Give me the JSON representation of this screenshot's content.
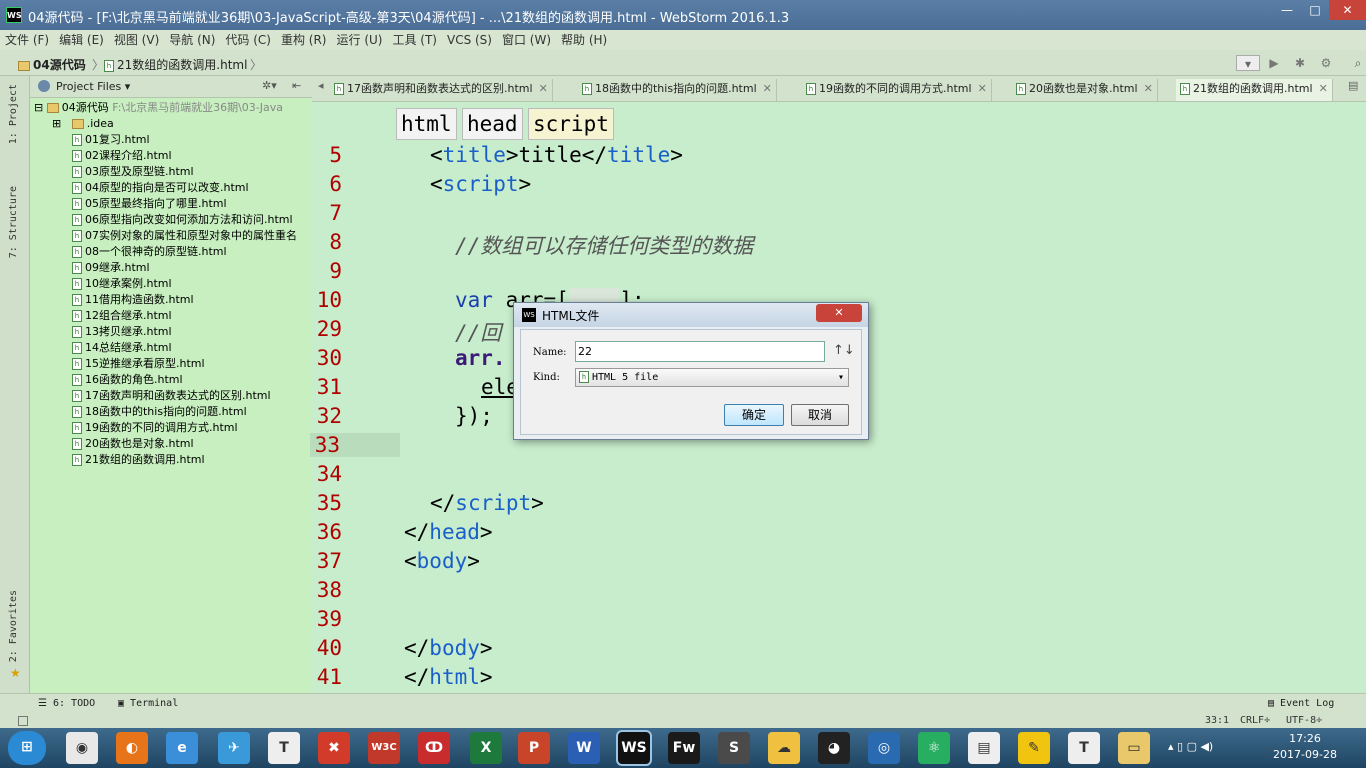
{
  "window": {
    "app_icon": "WS",
    "title": "04源代码 - [F:\\北京黑马前端就业36期\\03-JavaScript-高级-第3天\\04源代码] - ...\\21数组的函数调用.html - WebStorm 2016.1.3",
    "min": "—",
    "max": "□",
    "close": "✕"
  },
  "menu": [
    "文件 (F)",
    "编辑 (E)",
    "视图 (V)",
    "导航 (N)",
    "代码 (C)",
    "重构 (R)",
    "运行 (U)",
    "工具 (T)",
    "VCS (S)",
    "窗口 (W)",
    "帮助 (H)"
  ],
  "nav": {
    "crumb1": "04源代码",
    "crumb2": "21数组的函数调用.html",
    "sep": "〉"
  },
  "side_tabs": {
    "project": "1: Project",
    "structure": "7: Structure",
    "favorites": "2: Favorites"
  },
  "project": {
    "header": "Project Files",
    "root": "04源代码",
    "root_path": "F:\\北京黑马前端就业36期\\03-Java",
    "idea": ".idea",
    "files": [
      "01复习.html",
      "02课程介绍.html",
      "03原型及原型链.html",
      "04原型的指向是否可以改变.html",
      "05原型最终指向了哪里.html",
      "06原型指向改变如何添加方法和访问.html",
      "07实例对象的属性和原型对象中的属性重名",
      "08一个很神奇的原型链.html",
      "09继承.html",
      "10继承案例.html",
      "11借用构造函数.html",
      "12组合继承.html",
      "13拷贝继承.html",
      "14总结继承.html",
      "15逆推继承看原型.html",
      "16函数的角色.html",
      "17函数声明和函数表达式的区别.html",
      "18函数中的this指向的问题.html",
      "19函数的不同的调用方式.html",
      "20函数也是对象.html",
      "21数组的函数调用.html"
    ]
  },
  "tabs": [
    "17函数声明和函数表达式的区别.html",
    "18函数中的this指向的问题.html",
    "19函数的不同的调用方式.html",
    "20函数也是对象.html",
    "21数组的函数调用.html"
  ],
  "editor": {
    "breadcrumbs": [
      "html",
      "head",
      "script"
    ],
    "line_numbers": [
      "5",
      "6",
      "7",
      "8",
      "9",
      "10",
      "29",
      "30",
      "31",
      "32",
      "33",
      "34",
      "35",
      "36",
      "37",
      "38",
      "39",
      "40",
      "41"
    ],
    "lines": {
      "l5_open": "<",
      "l5_tag": "title",
      "l5_mid": ">title</",
      "l5_tag2": "title",
      "l5_close": ">",
      "l6_open": "<",
      "l6_tag": "script",
      "l6_close": ">",
      "l8": "//数组可以存储任何类型的数据",
      "l10_kw": "var",
      "l10_rest": " arr=[",
      "l10_end": "];",
      "l29": "//回",
      "l30": "arr.",
      "l31": "ele",
      "l32": "});",
      "l35_open": "</",
      "l35_tag": "script",
      "l35_close": ">",
      "l36_open": "</",
      "l36_tag": "head",
      "l36_close": ">",
      "l37_open": "<",
      "l37_tag": "body",
      "l37_close": ">",
      "l40_open": "</",
      "l40_tag": "body",
      "l40_close": ">",
      "l41_open": "</",
      "l41_tag": "html",
      "l41_close": ">"
    }
  },
  "dialog": {
    "title": "HTML文件",
    "name_label": "Name:",
    "name_value": "22",
    "kind_label": "Kind:",
    "kind_value": "HTML 5 file",
    "ok": "确定",
    "cancel": "取消",
    "sort": "↑↓"
  },
  "bottom": {
    "todo": "6: TODO",
    "terminal": "Terminal",
    "event_log": "Event Log",
    "status_pos": "33:1",
    "status_crlf": "CRLF÷",
    "status_enc": "UTF-8÷"
  },
  "taskbar": {
    "time": "17:26",
    "date": "2017-09-28",
    "apps": [
      "start",
      "chrome",
      "firefox",
      "ie",
      "feiq",
      "typora",
      "xmind",
      "w3c",
      "foxit",
      "excel",
      "powerpoint",
      "word",
      "webstorm",
      "fireworks",
      "sublime",
      "weather",
      "qq",
      "video",
      "atom",
      "notepad",
      "pencil",
      "typora2",
      "folder"
    ]
  }
}
